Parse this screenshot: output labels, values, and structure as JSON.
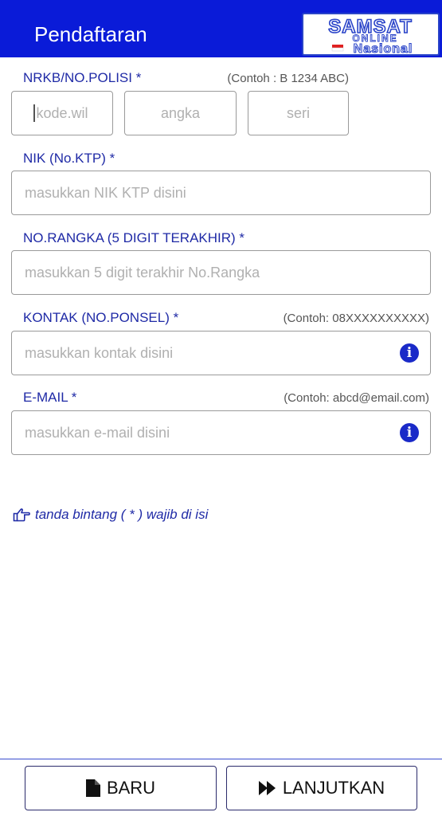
{
  "header": {
    "title": "Pendaftaran",
    "logo": {
      "line1": "SAMSAT",
      "line2": "ONLINE",
      "line3": "Nasional"
    }
  },
  "form": {
    "nrkb": {
      "label": "NRKB/NO.POLISI *",
      "hint": "(Contoh : B 1234 ABC)",
      "kode_placeholder": "kode.wil",
      "angka_placeholder": "angka",
      "seri_placeholder": "seri"
    },
    "nik": {
      "label": "NIK (No.KTP) *",
      "placeholder": "masukkan NIK KTP disini"
    },
    "rangka": {
      "label": "NO.RANGKA (5 DIGIT TERAKHIR) *",
      "placeholder": "masukkan 5 digit terakhir No.Rangka"
    },
    "kontak": {
      "label": "KONTAK (NO.PONSEL) *",
      "hint": "(Contoh: 08XXXXXXXXXX)",
      "placeholder": "masukkan kontak disini",
      "info_icon": "i"
    },
    "email": {
      "label": "E-MAIL *",
      "hint": "(Contoh: abcd@email.com)",
      "placeholder": "masukkan e-mail disini",
      "info_icon": "i"
    }
  },
  "note": {
    "text": "tanda bintang ( * ) wajib di isi",
    "icon": "hand-point-right-icon"
  },
  "actions": {
    "baru_label": "BARU",
    "baru_icon": "file-icon",
    "lanjutkan_label": "LANJUTKAN",
    "lanjutkan_icon": "fast-forward-icon"
  },
  "colors": {
    "brand_blue": "#0a1bd8",
    "label_blue": "#1f2aa6",
    "icon_blue": "#1a2ac8"
  }
}
